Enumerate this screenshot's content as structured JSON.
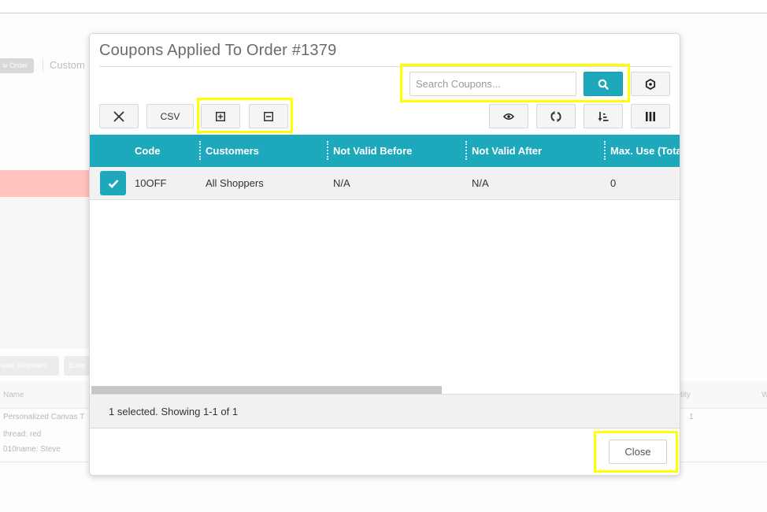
{
  "background": {
    "order_button": "w Order",
    "customer_link": "Custom",
    "buttons": [
      "Create Shipment",
      "Enter"
    ],
    "table": {
      "headers": {
        "name": "Name",
        "quantity": "tity",
        "w": "W"
      },
      "item_name": "Personalized Canvas T",
      "options": [
        "thread: red",
        "010name: Steve"
      ],
      "quantity": "1"
    }
  },
  "modal": {
    "title": "Coupons Applied To Order #1379",
    "search": {
      "placeholder": "Search Coupons...",
      "value": ""
    },
    "toolbar": {
      "clear_label": "✕",
      "csv_label": "CSV",
      "icons": [
        "close-icon",
        "expand-icon",
        "collapse-icon",
        "eye-icon",
        "refresh-icon",
        "sort-icon",
        "columns-icon",
        "search-icon",
        "settings-icon"
      ]
    },
    "table": {
      "columns": [
        "Code",
        "Customers",
        "Not Valid Before",
        "Not Valid After",
        "Max. Use (Total)"
      ],
      "rows": [
        {
          "selected": true,
          "code": "10OFF",
          "customers": "All Shoppers",
          "not_valid_before": "N/A",
          "not_valid_after": "N/A",
          "max_use": "0"
        }
      ]
    },
    "footer": {
      "status": "1 selected. Showing 1-1 of 1"
    },
    "close_label": "Close"
  },
  "colors": {
    "accent": "#1ea8bb",
    "highlight": "#ffff00",
    "alert": "#ffc2bd"
  }
}
